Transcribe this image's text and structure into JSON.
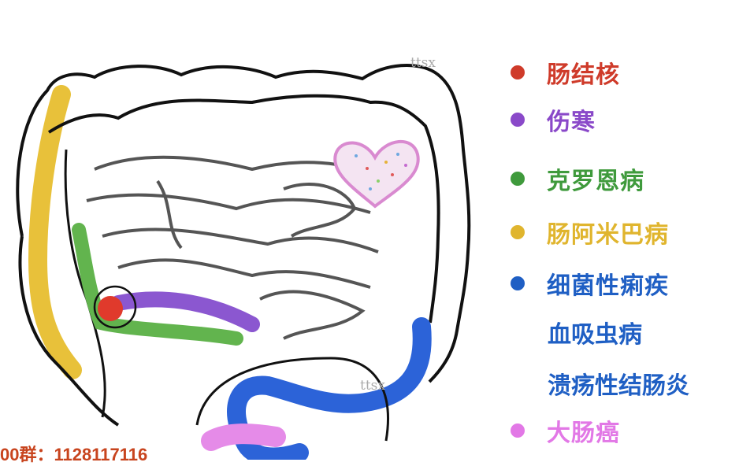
{
  "legend": [
    {
      "label": "肠结核",
      "color": "#cf3b2a",
      "icon": "red-dot-icon"
    },
    {
      "label": "伤寒",
      "color": "#8a49c9",
      "icon": "purple-dot-icon"
    },
    {
      "label": "克罗恩病",
      "color": "#3f9a3c",
      "icon": "green-dot-icon"
    },
    {
      "label": "肠阿米巴病",
      "color": "#e0b52e",
      "icon": "yellow-dot-icon"
    },
    {
      "label": "细菌性痢疾",
      "color": "#1f5fc4",
      "icon": "blue-dot-icon"
    },
    {
      "label": "大肠癌",
      "color": "#e278e6",
      "icon": "pink-dot-icon"
    }
  ],
  "legend_extra": [
    "血吸虫病",
    "溃疡性结肠炎"
  ],
  "watermarks": [
    "ttsx",
    "ttsx"
  ],
  "footer_text": "00群：1128117116",
  "illustration_icon": "large-intestine-diagram-icon"
}
